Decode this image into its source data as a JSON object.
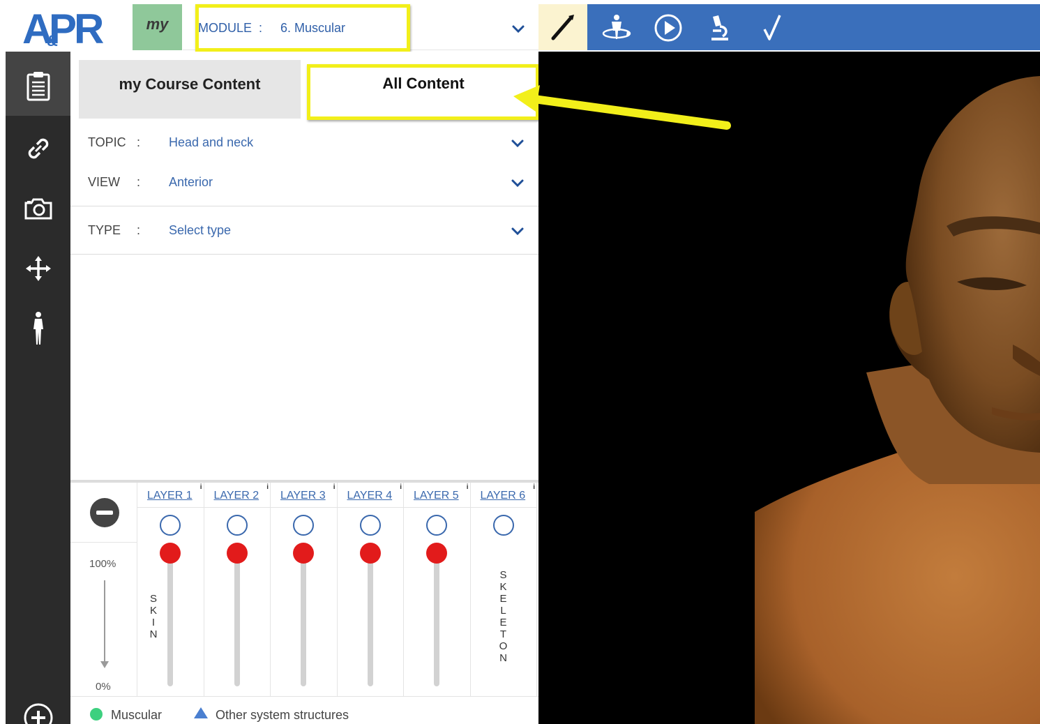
{
  "brand": {
    "logo_text": "A&PR",
    "logo_color": "#2f6cc1"
  },
  "header": {
    "my_label": "my",
    "module_label": "MODULE",
    "module_colon": ":",
    "module_value": "6. Muscular",
    "accent_blue": "#3a6fbb",
    "toolbar_icons": [
      "dissect-icon",
      "rotate-body-icon",
      "play-icon",
      "microscope-icon",
      "checkmark-icon"
    ]
  },
  "rail": {
    "items": [
      "clipboard-icon",
      "link-icon",
      "camera-icon",
      "move-arrows-icon",
      "human-figure-icon",
      "plus-icon"
    ]
  },
  "tabs": [
    {
      "label": "my Course Content",
      "active": false
    },
    {
      "label": "All Content",
      "active": true
    }
  ],
  "filters": [
    {
      "label": "TOPIC",
      "colon": ":",
      "value": "Head and neck"
    },
    {
      "label": "VIEW",
      "colon": ":",
      "value": "Anterior"
    },
    {
      "label": "TYPE",
      "colon": ":",
      "value": "Select type"
    }
  ],
  "layers": {
    "pct_top": "100%",
    "pct_bottom": "0%",
    "columns": [
      {
        "label": "LAYER 1",
        "info": "i",
        "has_slider": true,
        "vertical_label": "SKIN",
        "opacity": 1.0
      },
      {
        "label": "LAYER 2",
        "info": "i",
        "has_slider": true,
        "vertical_label": "",
        "opacity": 1.0
      },
      {
        "label": "LAYER 3",
        "info": "i",
        "has_slider": true,
        "vertical_label": "",
        "opacity": 1.0
      },
      {
        "label": "LAYER 4",
        "info": "i",
        "has_slider": true,
        "vertical_label": "",
        "opacity": 1.0
      },
      {
        "label": "LAYER 5",
        "info": "i",
        "has_slider": true,
        "vertical_label": "",
        "opacity": 1.0
      },
      {
        "label": "LAYER 6",
        "info": "i",
        "has_slider": false,
        "vertical_label": "SKELETON",
        "opacity": null
      }
    ]
  },
  "legend": [
    {
      "label": "Muscular",
      "color": "#3dd07f",
      "shape": "circle"
    },
    {
      "label": "Other system structures",
      "color": "#4a7fd0",
      "shape": "triangle"
    }
  ],
  "annotation": {
    "highlight_color": "#f2ef1a"
  }
}
